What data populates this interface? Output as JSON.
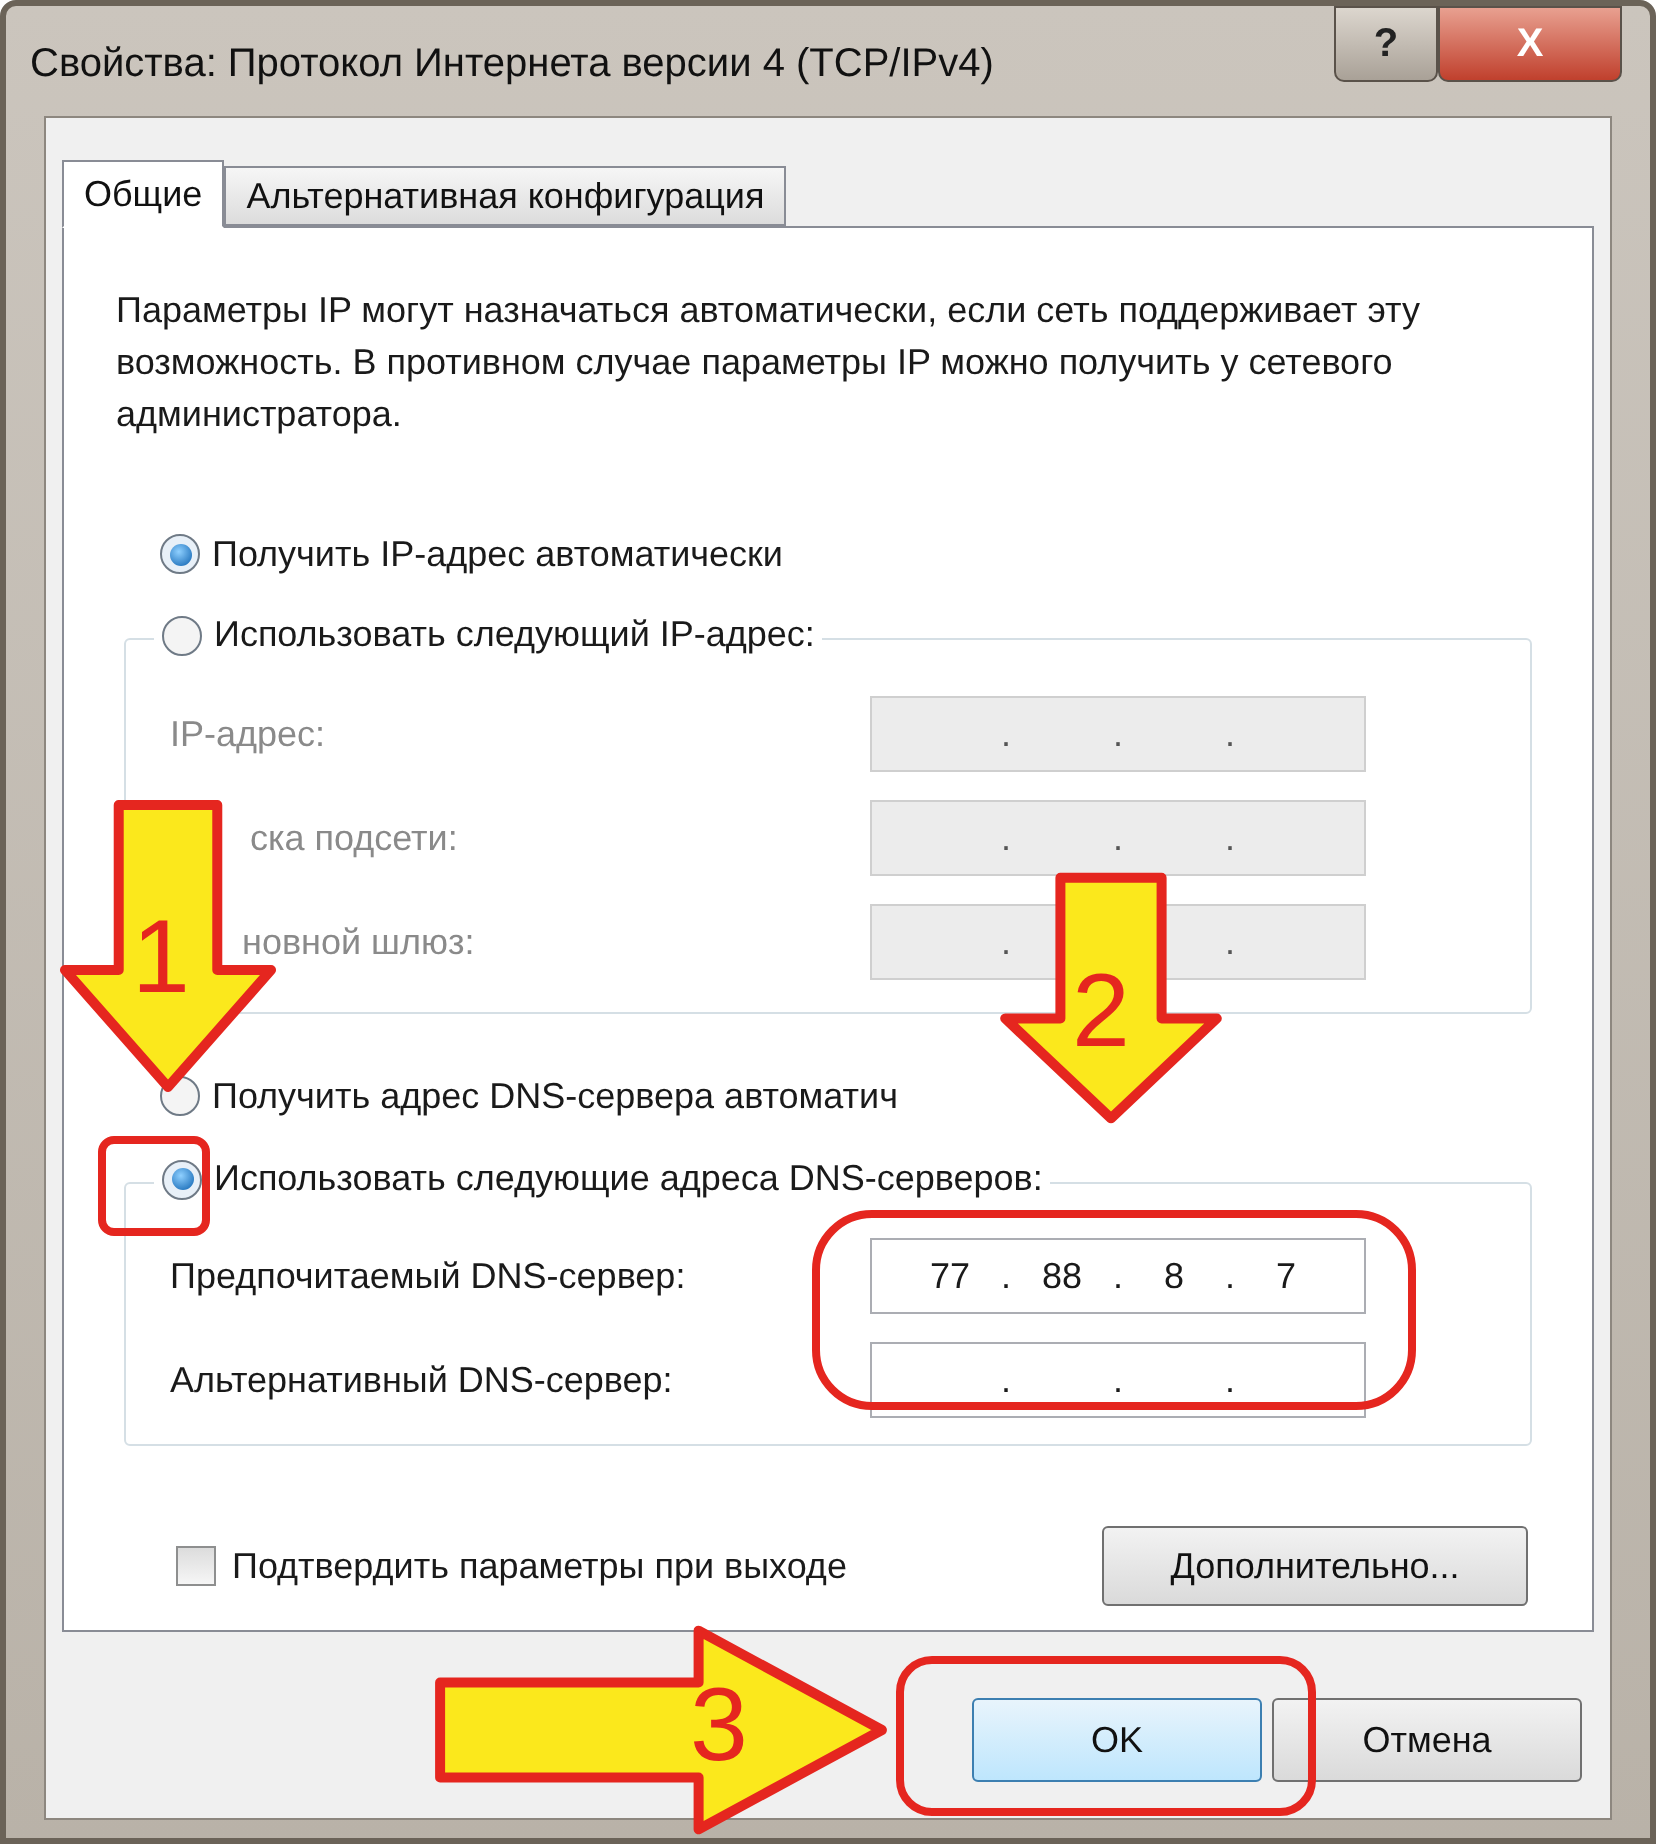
{
  "window": {
    "title": "Свойства: Протокол Интернета версии 4 (TCP/IPv4)",
    "controls": [
      {
        "kind": "help",
        "label": "?"
      },
      {
        "kind": "close",
        "label": "X"
      }
    ]
  },
  "tabs": [
    {
      "label": "Общие",
      "selected": true
    },
    {
      "label": "Альтернативная конфигурация",
      "selected": false
    }
  ],
  "description": "Параметры IP могут назначаться автоматически, если сеть поддерживает эту возможность. В противном случае параметры IP можно получить у сетевого администратора.",
  "ip_auto": {
    "label": "Получить IP-адрес автоматически",
    "selected": true
  },
  "ip_group": {
    "radio": {
      "label": "Использовать следующий IP-адрес:",
      "selected": false
    },
    "fields": [
      {
        "label": "IP-адрес:",
        "disabled": true,
        "separators": [
          {
            "text": "."
          },
          {
            "text": "."
          },
          {
            "text": "."
          }
        ]
      },
      {
        "label": "ска подсети:",
        "disabled": true,
        "separators": [
          {
            "text": "."
          },
          {
            "text": "."
          },
          {
            "text": "."
          }
        ]
      },
      {
        "label": "новной шлюз:",
        "disabled": true,
        "separators": [
          {
            "text": "."
          },
          {
            "covered": true
          },
          {
            "text": "."
          }
        ]
      }
    ]
  },
  "dns_auto": {
    "label": "Получить адрес DNS-сервера автоматич",
    "selected": false
  },
  "dns_group": {
    "radio": {
      "label": "Использовать следующие адреса DNS-серверов:",
      "selected": true
    },
    "fields": [
      {
        "label": "Предпочитаемый DNS-сервер:",
        "disabled": false,
        "octets": [
          "77",
          "88",
          "8",
          "7"
        ],
        "separators": [
          {
            "text": "."
          },
          {
            "text": "."
          },
          {
            "text": "."
          }
        ]
      },
      {
        "label": "Альтернативный DNS-сервер:",
        "disabled": false,
        "separators": [
          {
            "text": "."
          },
          {
            "text": "."
          },
          {
            "text": "."
          }
        ]
      }
    ]
  },
  "confirm": {
    "label": "Подтвердить параметры при выходе",
    "checked": false
  },
  "advanced_button": "Дополнительно...",
  "buttons": [
    {
      "label": "OK",
      "default": true
    },
    {
      "label": "Отмена",
      "default": false
    }
  ],
  "annotations": [
    {
      "kind": "down",
      "label": "1"
    },
    {
      "kind": "down",
      "label": "2"
    },
    {
      "kind": "right",
      "label": "3"
    }
  ]
}
